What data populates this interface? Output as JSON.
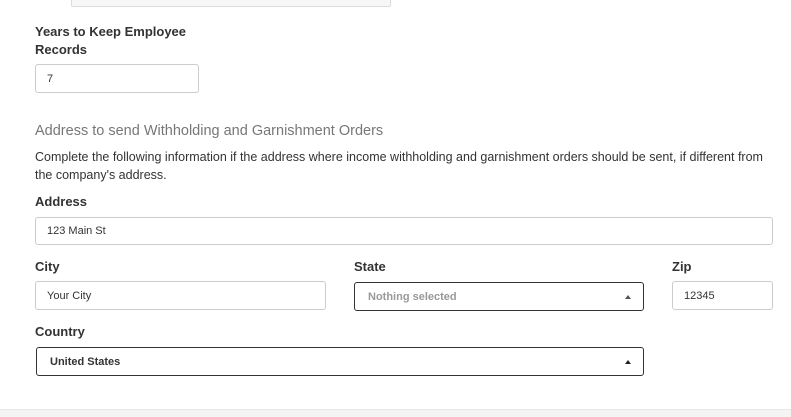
{
  "retention": {
    "label": "Years to Keep Employee Records",
    "value": "7"
  },
  "withholding_address": {
    "heading": "Address to send Withholding and Garnishment Orders",
    "description": "Complete the following information if the address where income withholding and garnishment orders should be sent, if different from the company's address.",
    "address": {
      "label": "Address",
      "value": "123 Main St"
    },
    "city": {
      "label": "City",
      "value": "Your City"
    },
    "state": {
      "label": "State",
      "value": "Nothing selected"
    },
    "zip": {
      "label": "Zip",
      "value": "12345"
    },
    "country": {
      "label": "Country",
      "value": "United States"
    }
  }
}
